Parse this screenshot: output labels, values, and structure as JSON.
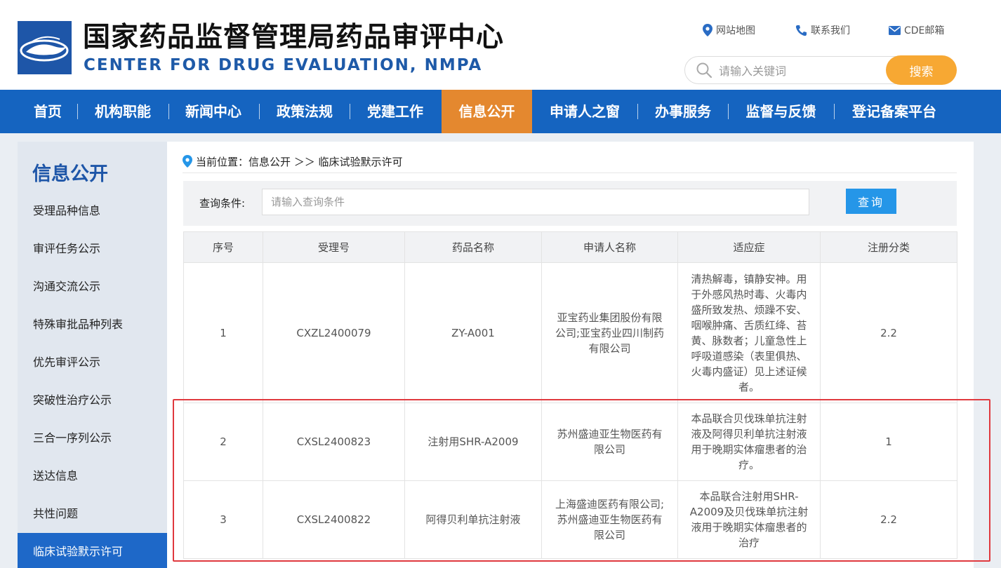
{
  "header": {
    "title_cn": "国家药品监督管理局药品审评中心",
    "title_en": "CENTER FOR DRUG EVALUATION, NMPA",
    "links": [
      {
        "label": "网站地图",
        "icon": "map-pin-icon"
      },
      {
        "label": "联系我们",
        "icon": "phone-icon"
      },
      {
        "label": "CDE邮箱",
        "icon": "mail-icon"
      }
    ],
    "search_placeholder": "请输入关键词",
    "search_button": "搜索"
  },
  "nav": {
    "items": [
      "首页",
      "机构职能",
      "新闻中心",
      "政策法规",
      "党建工作",
      "信息公开",
      "申请人之窗",
      "办事服务",
      "监督与反馈",
      "登记备案平台"
    ],
    "active_index": 5
  },
  "sidebar": {
    "title": "信息公开",
    "items": [
      "受理品种信息",
      "审评任务公示",
      "沟通交流公示",
      "特殊审批品种列表",
      "优先审评公示",
      "突破性治疗公示",
      "三合一序列公示",
      "送达信息",
      "共性问题",
      "临床试验默示许可"
    ],
    "active_index": 9
  },
  "breadcrumb": {
    "prefix": "当前位置：",
    "path": "信息公开 ＞＞ 临床试验默示许可"
  },
  "query": {
    "label": "查询条件:",
    "placeholder": "请输入查询条件",
    "button": "查询"
  },
  "table": {
    "columns": [
      "序号",
      "受理号",
      "药品名称",
      "申请人名称",
      "适应症",
      "注册分类"
    ],
    "rows": [
      [
        "1",
        "CXZL2400079",
        "ZY-A001",
        "亚宝药业集团股份有限公司;亚宝药业四川制药有限公司",
        "清热解毒，镇静安神。用于外感风热时毒、火毒内盛所致发热、烦躁不安、咽喉肿痛、舌质红绛、苔黄、脉数者；儿童急性上呼吸道感染（表里俱热、火毒内盛证）见上述证候者。",
        "2.2"
      ],
      [
        "2",
        "CXSL2400823",
        "注射用SHR-A2009",
        "苏州盛迪亚生物医药有限公司",
        "本品联合贝伐珠单抗注射液及阿得贝利单抗注射液用于晚期实体瘤患者的治疗。",
        "1"
      ],
      [
        "3",
        "CXSL2400822",
        "阿得贝利单抗注射液",
        "上海盛迪医药有限公司;苏州盛迪亚生物医药有限公司",
        "本品联合注射用SHR-A2009及贝伐珠单抗注射液用于晚期实体瘤患者的治疗",
        "2.2"
      ]
    ]
  },
  "colors": {
    "nav_bg": "#1564c0",
    "nav_active": "#e4882f",
    "brand_blue": "#1e56a8",
    "search_button": "#f7a833",
    "query_button": "#2596e8",
    "highlight_border": "#e0393e"
  }
}
